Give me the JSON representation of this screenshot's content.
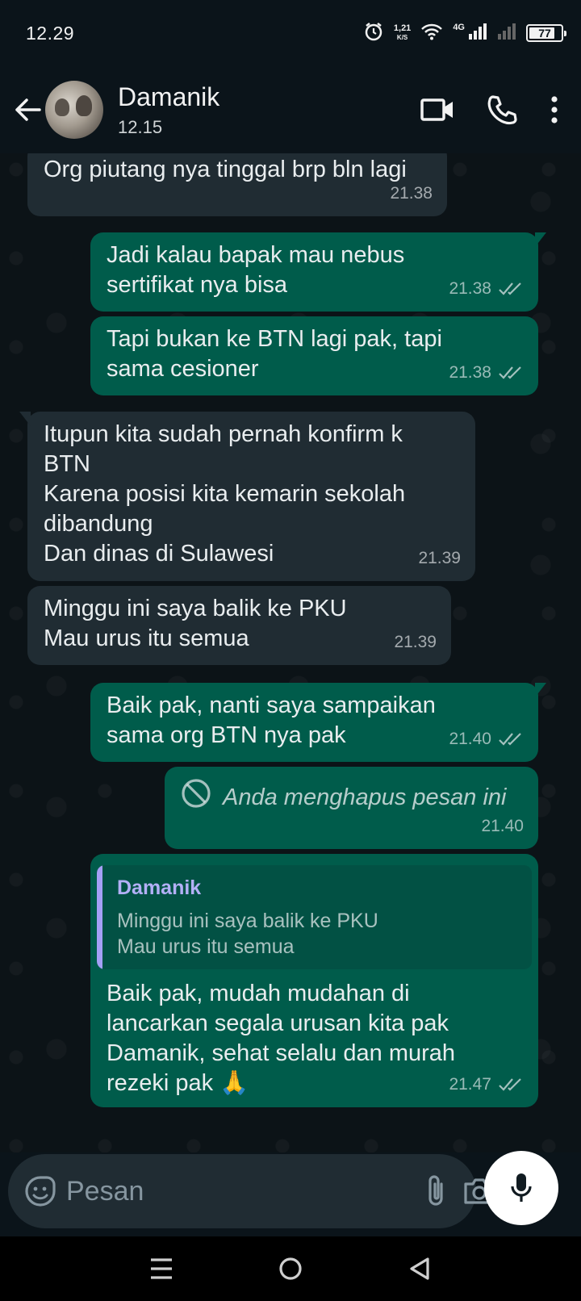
{
  "status_bar": {
    "time": "12.29",
    "speed_value": "1,21",
    "speed_unit": "K/S",
    "network": "4G",
    "battery": "77"
  },
  "header": {
    "contact_name": "Damanik",
    "last_seen": "12.15",
    "icons": [
      "back-arrow-icon",
      "video-call-icon",
      "voice-call-icon",
      "more-options-icon"
    ]
  },
  "messages": [
    {
      "direction": "in",
      "text": "Org piutang nya tinggal brp bln lagi",
      "time": "21.38"
    },
    {
      "direction": "out",
      "text": "Jadi kalau bapak mau nebus\nsertifikat nya bisa",
      "time": "21.38",
      "status": "read"
    },
    {
      "direction": "out",
      "text": "Tapi bukan ke BTN lagi pak, tapi\nsama cesioner",
      "time": "21.38",
      "status": "read"
    },
    {
      "direction": "in",
      "text": "Itupun kita sudah pernah konfirm k\nBTN\nKarena posisi kita kemarin sekolah\ndibandung\nDan dinas di Sulawesi",
      "time": "21.39"
    },
    {
      "direction": "in",
      "text": "Minggu ini saya balik ke PKU\nMau urus itu semua",
      "time": "21.39"
    },
    {
      "direction": "out",
      "text": "Baik pak, nanti saya sampaikan\nsama org BTN nya pak",
      "time": "21.40",
      "status": "read"
    },
    {
      "direction": "out",
      "deleted": true,
      "text": "Anda menghapus pesan ini",
      "time": "21.40"
    },
    {
      "direction": "out",
      "quote": {
        "name": "Damanik",
        "text": "Minggu ini saya balik ke PKU\nMau urus itu semua"
      },
      "text": "Baik pak, mudah mudahan di\nlancarkan segala urusan kita pak\nDamanik, sehat selalu dan murah\nrezeki pak 🙏",
      "time": "21.47",
      "status": "read"
    }
  ],
  "input": {
    "placeholder": "Pesan"
  },
  "colors": {
    "background": "#0b141a",
    "incoming_bubble": "#202c33",
    "outgoing_bubble": "#005c4b",
    "quote_accent": "#a5a0f5"
  }
}
